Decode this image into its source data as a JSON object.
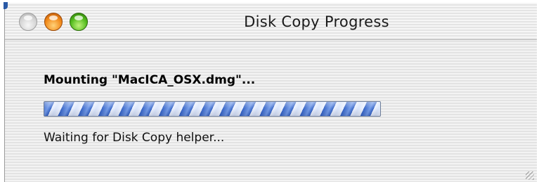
{
  "window": {
    "title": "Disk Copy Progress",
    "buttons": [
      {
        "name": "close",
        "color": "#d0d0d0"
      },
      {
        "name": "minimize",
        "color": "#f18a1a"
      },
      {
        "name": "zoom",
        "color": "#52bb1c"
      }
    ]
  },
  "content": {
    "mounting_text": "Mounting \"MacICA_OSX.dmg\"...",
    "progress": {
      "state": "indeterminate",
      "accent": "#2f5fc4"
    },
    "status_text": "Waiting for Disk Copy helper..."
  }
}
